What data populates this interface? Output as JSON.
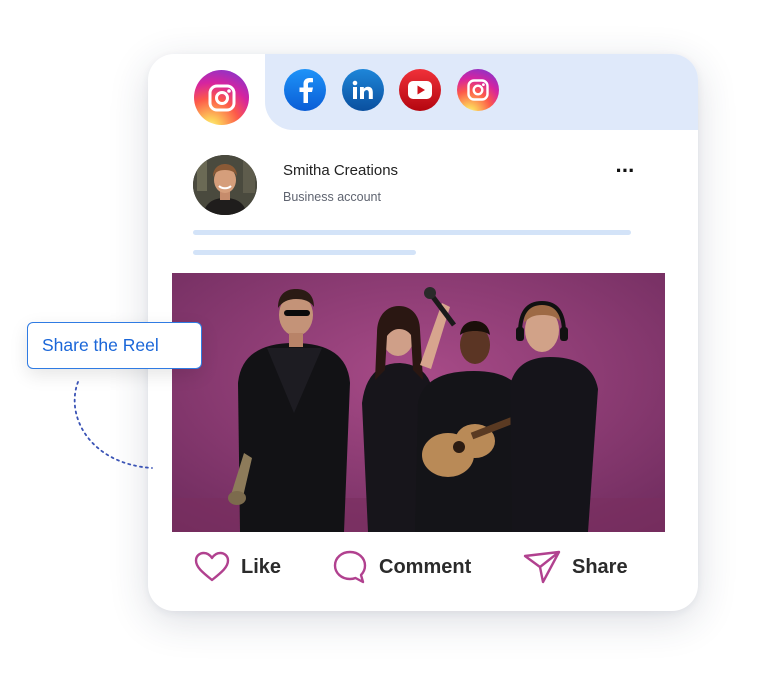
{
  "tabs": {
    "active": "instagram-icon",
    "items": [
      "facebook-icon",
      "linkedin-icon",
      "youtube-icon",
      "instagram-icon"
    ]
  },
  "post": {
    "author_name": "Smitha Creations",
    "account_type": "Business account",
    "more_label": "···"
  },
  "actions": {
    "like": "Like",
    "comment": "Comment",
    "share": "Share"
  },
  "callout": {
    "label": "Share the Reel"
  },
  "colors": {
    "accent_blue": "#1a66d8",
    "tab_bar": "#dfe9fa",
    "action_icon": "#b1418f",
    "photo_background": "#8e3a6f"
  }
}
